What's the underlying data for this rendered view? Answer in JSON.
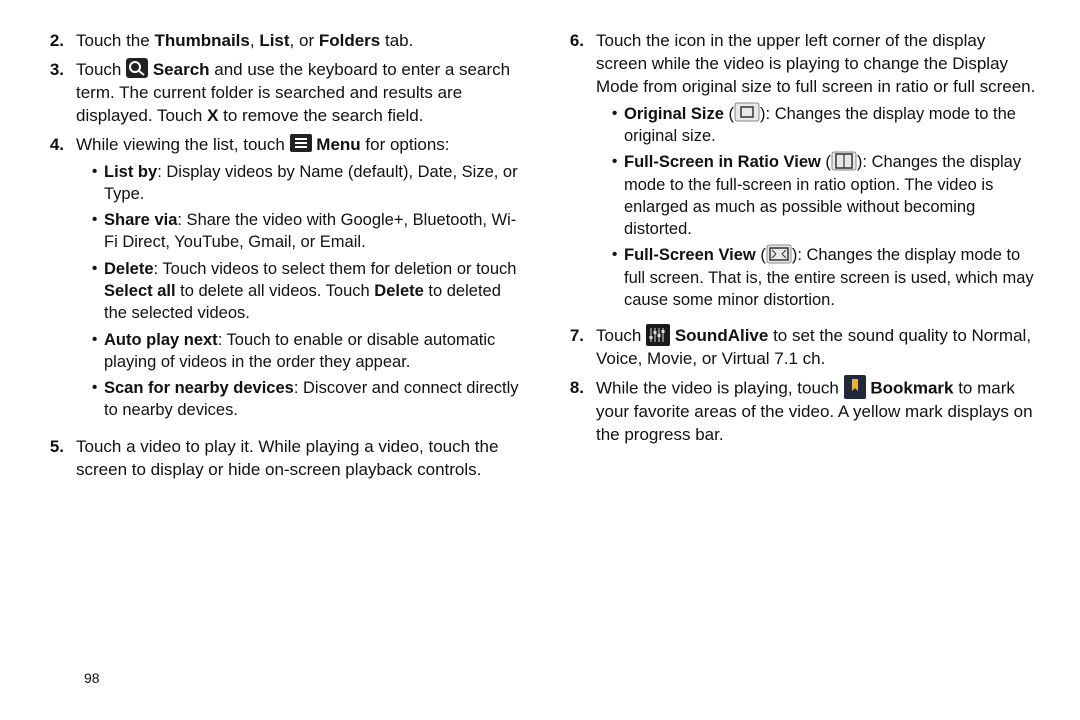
{
  "page_number": "98",
  "left": {
    "s2": {
      "num": "2.",
      "p1a": "Touch the ",
      "p1b": "Thumbnails",
      "p1c": ", ",
      "p1d": "List",
      "p1e": ", or ",
      "p1f": "Folders",
      "p1g": " tab."
    },
    "s3": {
      "num": "3.",
      "p1a": "Touch ",
      "p1b": "Search",
      "p1c": " and use the keyboard to enter a search term. The current folder is searched and results are displayed. Touch ",
      "p1d": "X",
      "p1e": " to remove the search field."
    },
    "s4": {
      "num": "4.",
      "p1a": "While viewing the list, touch ",
      "p1b": "Menu",
      "p1c": " for options:",
      "bullets": {
        "b1a": "List by",
        "b1b": ": Display videos by Name (default), Date, Size, or Type.",
        "b2a": "Share via",
        "b2b": ": Share the video with Google+, Bluetooth, Wi-Fi Direct, YouTube, Gmail, or Email.",
        "b3a": "Delete",
        "b3b": ": Touch videos to select them for deletion or touch ",
        "b3c": "Select all",
        "b3d": " to delete all videos. Touch ",
        "b3e": "Delete",
        "b3f": " to deleted the selected videos.",
        "b4a": "Auto play next",
        "b4b": ": Touch to enable or disable automatic playing of videos in the order they appear.",
        "b5a": "Scan for nearby devices",
        "b5b": ": Discover and connect directly to nearby devices."
      }
    },
    "s5": {
      "num": "5.",
      "p1": "Touch a video to play it. While playing a video, touch the screen to display or hide on-screen playback controls."
    }
  },
  "right": {
    "s6": {
      "num": "6.",
      "p1": "Touch the icon in the upper left corner of the display screen while the video is playing to change the Display Mode from original size to full screen in ratio or full screen.",
      "bullets": {
        "b1a": "Original Size",
        "b1b": " (",
        "b1c": "): Changes the display mode to the original size.",
        "b2a": "Full-Screen in Ratio View",
        "b2b": " (",
        "b2c": "): Changes the display mode to the full-screen in ratio option. The video is enlarged as much as possible without becoming distorted.",
        "b3a": "Full-Screen View",
        "b3b": " (",
        "b3c": "): Changes the display mode to full screen. That is, the entire screen is used, which may cause some minor distortion."
      }
    },
    "s7": {
      "num": "7.",
      "p1a": "Touch ",
      "p1b": "SoundAlive",
      "p1c": " to set the sound quality to Normal, Voice, Movie, or Virtual 7.1 ch."
    },
    "s8": {
      "num": "8.",
      "p1a": "While the video is playing, touch ",
      "p1b": "Bookmark",
      "p1c": " to mark your favorite areas of the video. A yellow mark displays on the progress bar."
    }
  }
}
